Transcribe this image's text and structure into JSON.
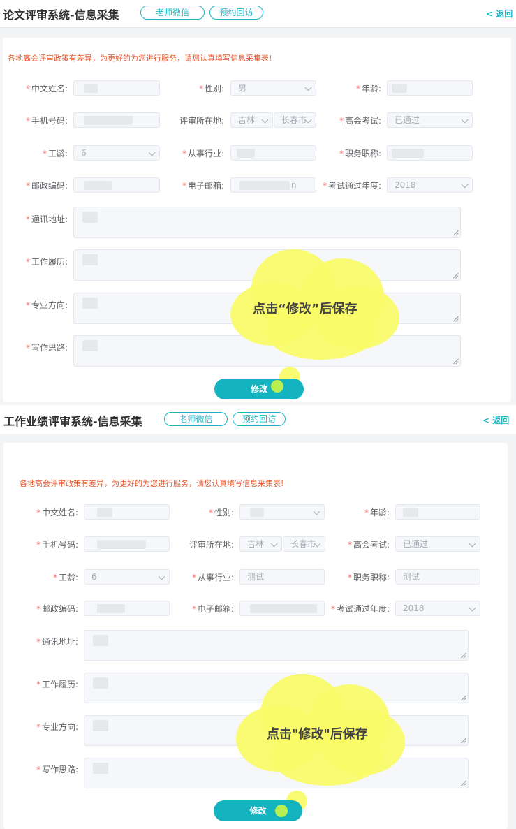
{
  "colors": {
    "accent": "#1fb6c4",
    "required": "#f56c6c",
    "notice": "#e4572e",
    "highlight": "#f8fb67"
  },
  "section1": {
    "title": "论文评审系统-信息采集",
    "pills": [
      "老师微信",
      "预约回访"
    ],
    "back": "< 返回",
    "notice": "各地高会评审政策有差异，为更好的为您进行服务，请您认真填写信息采集表!",
    "labels": {
      "name": "中文姓名:",
      "gender": "性别:",
      "age": "年龄:",
      "phone": "手机号码:",
      "location": "评审所在地:",
      "exam": "高会考试:",
      "seniority": "工龄:",
      "industry": "从事行业:",
      "position": "职务职称:",
      "zip": "邮政编码:",
      "email": "电子邮箱:",
      "exam_year": "考试通过年度:",
      "address": "通讯地址:",
      "resume": "工作履历:",
      "major": "专业方向:",
      "writing": "写作思路:"
    },
    "values": {
      "gender": "男",
      "province": "吉林",
      "city": "长春市",
      "exam": "已通过",
      "seniority": "6",
      "email_tail": "n",
      "exam_year": "2018"
    },
    "button": "修改",
    "callout": "点击“修改”后保存"
  },
  "section2": {
    "title": "工作业绩评审系统-信息采集",
    "pills": [
      "老师微信",
      "预约回访"
    ],
    "back": "< 返回",
    "notice": "各地高会评审政策有差异，为更好的为您进行服务，请您认真填写信息采集表!",
    "labels": {
      "name": "中文姓名:",
      "gender": "性别:",
      "age": "年龄:",
      "phone": "手机号码:",
      "location": "评审所在地:",
      "exam": "高会考试:",
      "seniority": "工龄:",
      "industry": "从事行业:",
      "position": "职务职称:",
      "zip": "邮政编码:",
      "email": "电子邮箱:",
      "exam_year": "考试通过年度:",
      "address": "通讯地址:",
      "resume": "工作履历:",
      "major": "专业方向:",
      "writing": "写作思路:"
    },
    "values": {
      "province": "吉林",
      "city": "长春市",
      "exam": "已通过",
      "seniority": "6",
      "industry": "测试",
      "position": "测试",
      "exam_year": "2018"
    },
    "button": "修改",
    "callout": "点击\"修改\"后保存"
  }
}
